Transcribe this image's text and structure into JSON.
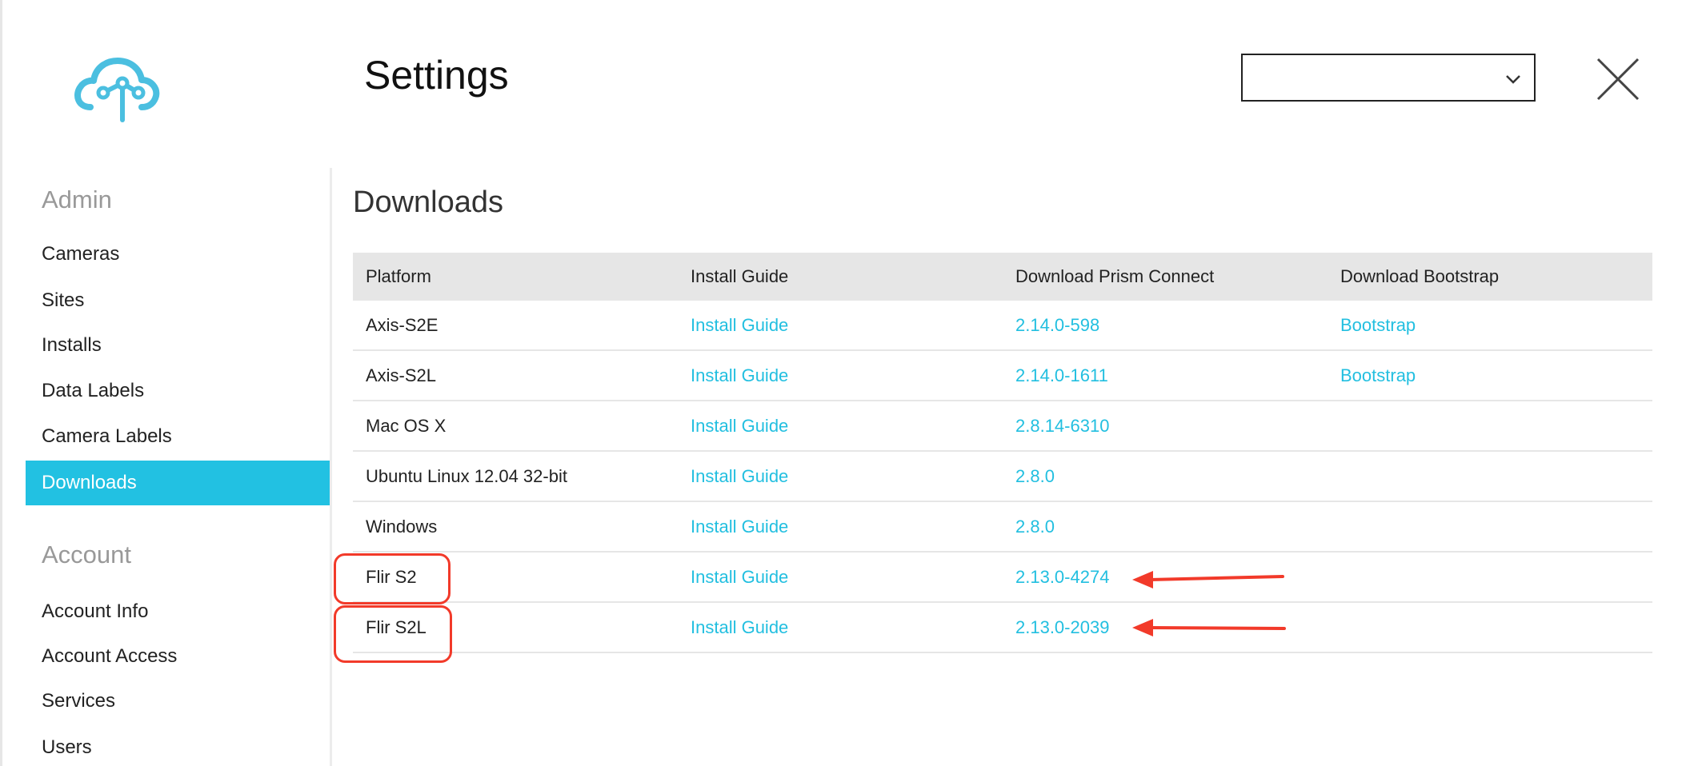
{
  "header": {
    "title": "Settings",
    "logo_icon": "cloud-network-icon",
    "select": {
      "value": "",
      "icon": "chevron-down-icon"
    },
    "close_icon": "close-icon"
  },
  "sidebar": {
    "sections": [
      {
        "heading": "Admin",
        "items": [
          "Cameras",
          "Sites",
          "Installs",
          "Data Labels",
          "Camera Labels",
          "Downloads"
        ]
      },
      {
        "heading": "Account",
        "items": [
          "Account Info",
          "Account Access",
          "Services",
          "Users"
        ]
      }
    ],
    "active_item": "Downloads"
  },
  "downloads": {
    "title": "Downloads",
    "columns": [
      "Platform",
      "Install Guide",
      "Download Prism Connect",
      "Download Bootstrap"
    ],
    "rows": [
      {
        "platform": "Axis-S2E",
        "guide": "Install Guide",
        "connect": "2.14.0-598",
        "bootstrap": "Bootstrap"
      },
      {
        "platform": "Axis-S2L",
        "guide": "Install Guide",
        "connect": "2.14.0-1611",
        "bootstrap": "Bootstrap"
      },
      {
        "platform": "Mac OS X",
        "guide": "Install Guide",
        "connect": "2.8.14-6310",
        "bootstrap": ""
      },
      {
        "platform": "Ubuntu Linux 12.04 32-bit",
        "guide": "Install Guide",
        "connect": "2.8.0",
        "bootstrap": ""
      },
      {
        "platform": "Windows",
        "guide": "Install Guide",
        "connect": "2.8.0",
        "bootstrap": ""
      },
      {
        "platform": "Flir S2",
        "guide": "Install Guide",
        "connect": "2.13.0-4274",
        "bootstrap": ""
      },
      {
        "platform": "Flir S2L",
        "guide": "Install Guide",
        "connect": "2.13.0-2039",
        "bootstrap": ""
      }
    ]
  },
  "colors": {
    "accent": "#22c1e2",
    "annotation": "#f23a2a",
    "header_bg": "#e6e6e6"
  }
}
